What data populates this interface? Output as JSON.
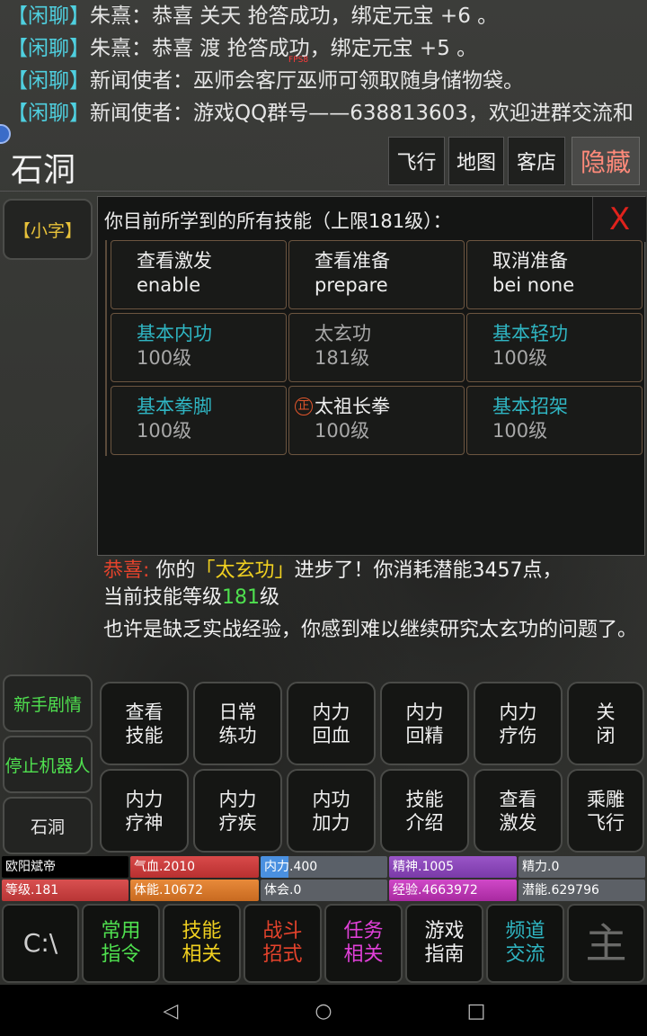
{
  "chat": [
    {
      "channel": "【闲聊】",
      "text": "朱熹：恭喜 关天 抢答成功，绑定元宝 +6 。"
    },
    {
      "channel": "【闲聊】",
      "text": "朱熹：恭喜 渡 抢答成功，绑定元宝 +5 。"
    },
    {
      "channel": "【闲聊】",
      "text": "新闻使者：巫师会客厅巫师可领取随身储物袋。"
    },
    {
      "channel": "【闲聊】",
      "text": "新闻使者：游戏QQ群号——638813603，欢迎进群交流和"
    }
  ],
  "fps": "FPS8",
  "location": "石洞",
  "top_buttons": {
    "fly": "飞行",
    "map": "地图",
    "inn": "客店",
    "hide": "隐藏"
  },
  "side_buttons": {
    "small_text": "【小字】",
    "newbie": "新手剧情",
    "stop_robot": "停止机器人",
    "cave": "石洞"
  },
  "skills_panel": {
    "title": "你目前所学到的所有技能（上限181级）：",
    "close": "X",
    "actions": [
      {
        "l1": "查看激发",
        "l2": "enable"
      },
      {
        "l1": "查看准备",
        "l2": "prepare"
      },
      {
        "l1": "取消准备",
        "l2": "bei none"
      }
    ],
    "skills": [
      {
        "name": "基本内功",
        "level": "100级"
      },
      {
        "name": "太玄功",
        "level": "181级"
      },
      {
        "name": "基本轻功",
        "level": "100级"
      },
      {
        "name": "基本拳脚",
        "level": "100级"
      },
      {
        "name": "太祖长拳",
        "level": "100级",
        "badge": "正"
      },
      {
        "name": "基本招架",
        "level": "100级"
      }
    ]
  },
  "message": {
    "congrats": "恭喜:",
    "p1": "你的",
    "skill": "「太玄功」",
    "p2": "进步了！你消耗潜能3457点，",
    "p3": "当前技能等级",
    "level": "181",
    "p4": "级",
    "p5": "也许是缺乏实战经验，你感到难以继续研究太玄功的问题了。"
  },
  "action_grid": [
    [
      "查看",
      "技能"
    ],
    [
      "日常",
      "练功"
    ],
    [
      "内力",
      "回血"
    ],
    [
      "内力",
      "回精"
    ],
    [
      "内力",
      "疗伤"
    ],
    [
      "关",
      "闭"
    ],
    [
      "内力",
      "疗神"
    ],
    [
      "内力",
      "疗疾"
    ],
    [
      "内功",
      "加力"
    ],
    [
      "技能",
      "介绍"
    ],
    [
      "查看",
      "激发"
    ],
    [
      "乘雕",
      "飞行"
    ]
  ],
  "stats": {
    "name": "欧阳斌帝",
    "qixue": "气血.2010",
    "neili": "内力.400",
    "jingshen": "精神.1005",
    "jingli": "精力.0",
    "dengji": "等级.181",
    "tineng": "体能.10672",
    "tihui": "体会.0",
    "jingyan": "经验.4663972",
    "qianneng": "潜能.629796"
  },
  "bottom_menu": {
    "console": "C:\\",
    "common": [
      "常用",
      "指令"
    ],
    "skills": [
      "技能",
      "相关"
    ],
    "combat": [
      "战斗",
      "招式"
    ],
    "quest": [
      "任务",
      "相关"
    ],
    "guide": [
      "游戏",
      "指南"
    ],
    "channel": [
      "频道",
      "交流"
    ],
    "main": "主"
  },
  "colors": {
    "cyan": "#2fb5c2",
    "red": "#e5432c",
    "green": "#4fe04f",
    "yellow": "#f0d020"
  }
}
